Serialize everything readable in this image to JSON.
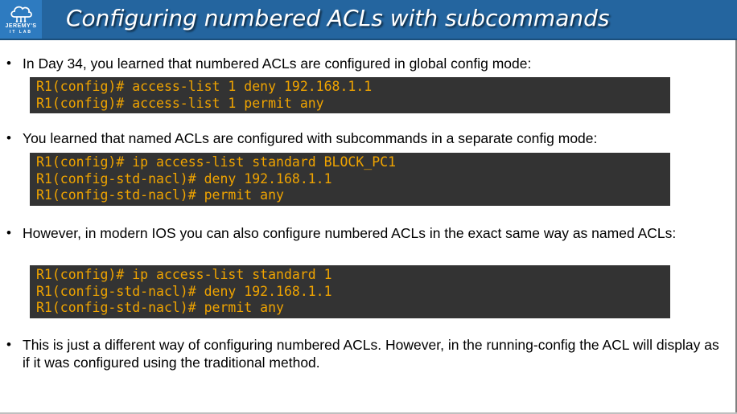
{
  "header": {
    "title": "Configuring numbered ACLs with subcommands",
    "logo_line1": "JEREMY'S",
    "logo_line2": "IT LAB",
    "logo_icon": "cloud-network-icon"
  },
  "colors": {
    "title_bar": "#24659f",
    "code_background": "#333333",
    "code_text": "#f0a400"
  },
  "bullets": [
    {
      "text": "In Day 34, you learned that numbered ACLs are configured in global config mode:",
      "code": [
        "R1(config)# access-list 1 deny 192.168.1.1",
        "R1(config)# access-list 1 permit any"
      ]
    },
    {
      "text": "You learned that named ACLs are configured with subcommands in a separate config mode:",
      "code": [
        "R1(config)# ip access-list standard BLOCK_PC1",
        "R1(config-std-nacl)# deny 192.168.1.1",
        "R1(config-std-nacl)# permit any"
      ]
    },
    {
      "text": "However, in modern IOS you can also configure numbered ACLs in the exact same way as named ACLs:",
      "code": [
        "R1(config)# ip access-list standard 1",
        "R1(config-std-nacl)# deny 192.168.1.1",
        "R1(config-std-nacl)# permit any"
      ]
    },
    {
      "text": "This is just a different way of configuring numbered ACLs.  However, in the running-config the ACL will display as if it was configured using the traditional method.",
      "code": []
    }
  ]
}
